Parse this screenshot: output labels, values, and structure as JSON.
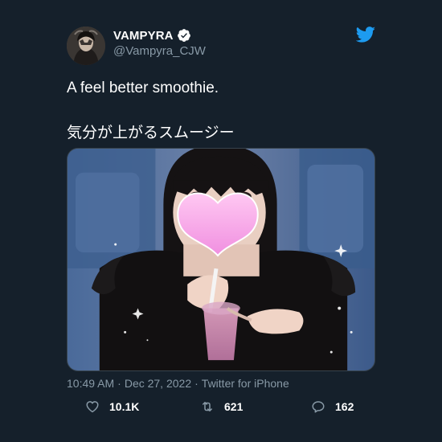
{
  "author": {
    "display_name": "VAMPYRA",
    "handle": "@Vampyra_CJW",
    "verified": true
  },
  "tweet": {
    "text_line_1": "A feel better smoothie.",
    "text_line_2": "気分が上がるスムージー",
    "time": "10:49 AM",
    "separator_1": "·",
    "date": "Dec 27, 2022",
    "separator_2": "·",
    "source": "Twitter for iPhone"
  },
  "actions": {
    "likes": "10.1K",
    "retweets": "621",
    "replies": "162"
  },
  "icons": {
    "brand": "twitter-bird-icon",
    "verified": "verified-badge-icon",
    "like": "heart-icon",
    "retweet": "retweet-icon",
    "reply": "reply-icon"
  },
  "colors": {
    "background": "#15202b",
    "secondary_text": "#8899a6",
    "twitter_blue": "#1d9bf0",
    "border": "#38444d"
  }
}
